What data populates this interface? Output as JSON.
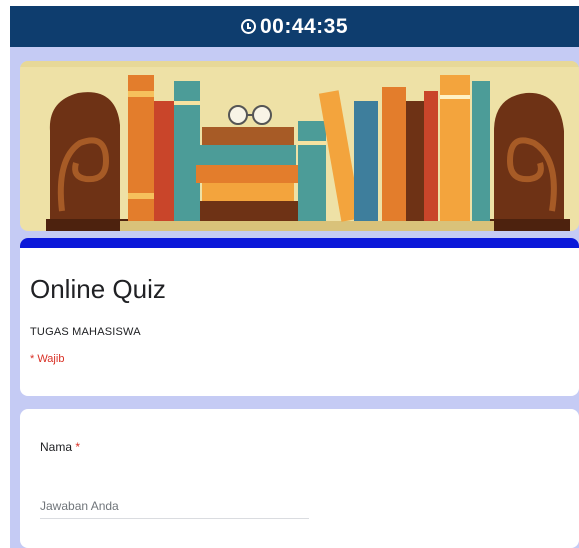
{
  "timer": {
    "icon": "clock-icon",
    "text": "00:44:35",
    "background": "#0e3d6e"
  },
  "banner": {
    "illustration": "bookshelf-with-bookends"
  },
  "form": {
    "title": "Online Quiz",
    "description": "TUGAS MAHASISWA",
    "required_note": "* Wajib",
    "accent_color": "#0b18d9",
    "page_background": "#c5cbf4"
  },
  "question": {
    "label": "Nama",
    "required_marker": "*",
    "placeholder": "Jawaban Anda",
    "value": ""
  }
}
